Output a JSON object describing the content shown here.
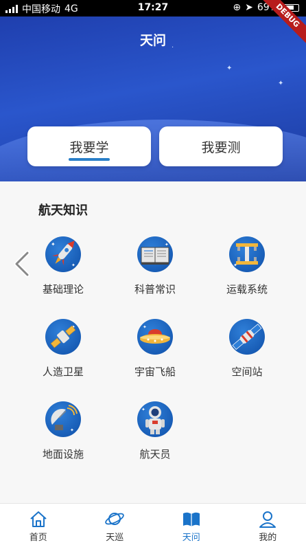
{
  "status_bar": {
    "carrier": "中国移动",
    "network": "4G",
    "time": "17:27",
    "battery": "69%",
    "debug_ribbon": "DEBUG"
  },
  "header": {
    "title": "天问",
    "tabs": [
      {
        "label": "我要学",
        "active": true
      },
      {
        "label": "我要测",
        "active": false
      }
    ]
  },
  "content": {
    "section_title": "航天知识",
    "items": [
      {
        "label": "基础理论",
        "icon": "rocket-icon"
      },
      {
        "label": "科普常识",
        "icon": "book-icon"
      },
      {
        "label": "运载系统",
        "icon": "launcher-icon"
      },
      {
        "label": "人造卫星",
        "icon": "satellite-icon"
      },
      {
        "label": "宇宙飞船",
        "icon": "spaceship-icon"
      },
      {
        "label": "空间站",
        "icon": "space-station-icon"
      },
      {
        "label": "地面设施",
        "icon": "radar-dish-icon"
      },
      {
        "label": "航天员",
        "icon": "astronaut-icon"
      }
    ]
  },
  "bottom_nav": [
    {
      "label": "首页",
      "icon": "home-icon",
      "active": false
    },
    {
      "label": "天巡",
      "icon": "planet-icon",
      "active": false
    },
    {
      "label": "天问",
      "icon": "open-book-icon",
      "active": true
    },
    {
      "label": "我的",
      "icon": "user-icon",
      "active": false
    }
  ],
  "colors": {
    "header": "#2a56cc",
    "accent": "#1a73c9",
    "icon_bg": "#1f64c2"
  }
}
